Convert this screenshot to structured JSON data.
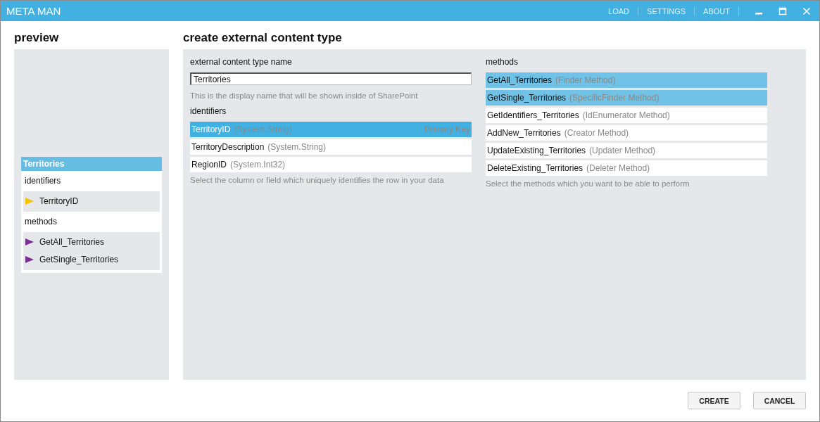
{
  "window": {
    "title": "META MAN",
    "menu": [
      "LOAD",
      "SETTINGS",
      "ABOUT"
    ]
  },
  "preview": {
    "heading": "preview",
    "entity": "Territories",
    "sections": [
      {
        "title": "identifiers",
        "color": "#f5c400",
        "items": [
          "TerritoryID"
        ]
      },
      {
        "title": "methods",
        "color": "#7a2f96",
        "items": [
          "GetAll_Territories",
          "GetSingle_Territories"
        ]
      }
    ]
  },
  "main": {
    "heading": "create external content type",
    "name_label": "external content type name",
    "name_value": "Territories",
    "name_hint": "This is the display name that will be shown inside of SharePoint",
    "identifiers_label": "identifiers",
    "identifiers": [
      {
        "name": "TerritoryID",
        "type": "(System.String)",
        "note": "Primary Key",
        "selected": true
      },
      {
        "name": "TerritoryDescription",
        "type": "(System.String)",
        "selected": false
      },
      {
        "name": "RegionID",
        "type": "(System.Int32)",
        "selected": false
      }
    ],
    "identifiers_hint": "Select the column or field which uniquely identifies the row in your data",
    "methods_label": "methods",
    "methods": [
      {
        "name": "GetAll_Territories",
        "type": "(Finder Method)",
        "selected": true
      },
      {
        "name": "GetSingle_Territories",
        "type": "(SpecificFinder Method)",
        "selected": true
      },
      {
        "name": "GetIdentifiers_Territories",
        "type": "(IdEnumerator Method)",
        "selected": false
      },
      {
        "name": "AddNew_Territories",
        "type": "(Creator Method)",
        "selected": false
      },
      {
        "name": "UpdateExisting_Territories",
        "type": "(Updater Method)",
        "selected": false
      },
      {
        "name": "DeleteExisting_Territories",
        "type": "(Deleter Method)",
        "selected": false
      }
    ],
    "methods_hint": "Select the methods which you want to be able to perform"
  },
  "buttons": [
    "CREATE",
    "CANCEL"
  ]
}
